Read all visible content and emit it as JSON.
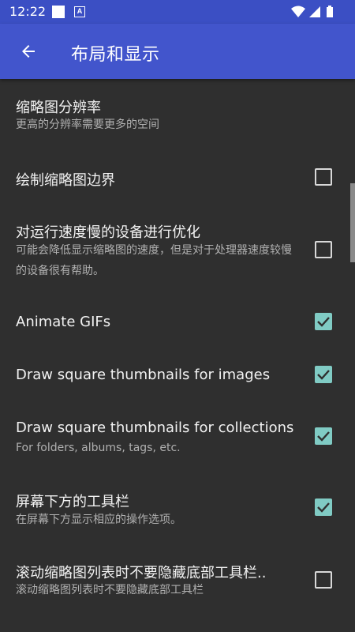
{
  "status_bar": {
    "time": "12:22",
    "notification_icons": [
      "square-icon",
      "font-app-icon"
    ],
    "system_icons": [
      "wifi-icon",
      "signal-icon",
      "battery-icon"
    ]
  },
  "app_bar": {
    "title": "布局和显示",
    "back_icon": "arrow-back-icon"
  },
  "colors": {
    "status_bar": "#3b4fc4",
    "app_bar": "#4255cc",
    "background": "#2f2f2f",
    "checkbox_accent": "#80cbc4"
  },
  "settings": [
    {
      "title": "缩略图分辨率",
      "summary": "更高的分辨率需要更多的空间"
    },
    {
      "title": "绘制缩略图边界",
      "checked": false
    },
    {
      "title": "对运行速度慢的设备进行优化",
      "summary": "可能会降低显示缩略图的速度，但是对于处理器速度较慢的设备很有帮助。",
      "checked": false
    },
    {
      "title": "Animate GIFs",
      "checked": true
    },
    {
      "title": "Draw square thumbnails for images",
      "checked": true
    },
    {
      "title": "Draw square thumbnails for collections",
      "summary": "For folders, albums, tags, etc.",
      "checked": true
    },
    {
      "title": "屏幕下方的工具栏",
      "summary": "在屏幕下方显示相应的操作选项。",
      "checked": true
    },
    {
      "title": "滚动缩略图列表时不要隐藏底部工具栏..",
      "summary": "滚动缩略图列表时不要隐藏底部工具栏",
      "checked": false
    }
  ]
}
